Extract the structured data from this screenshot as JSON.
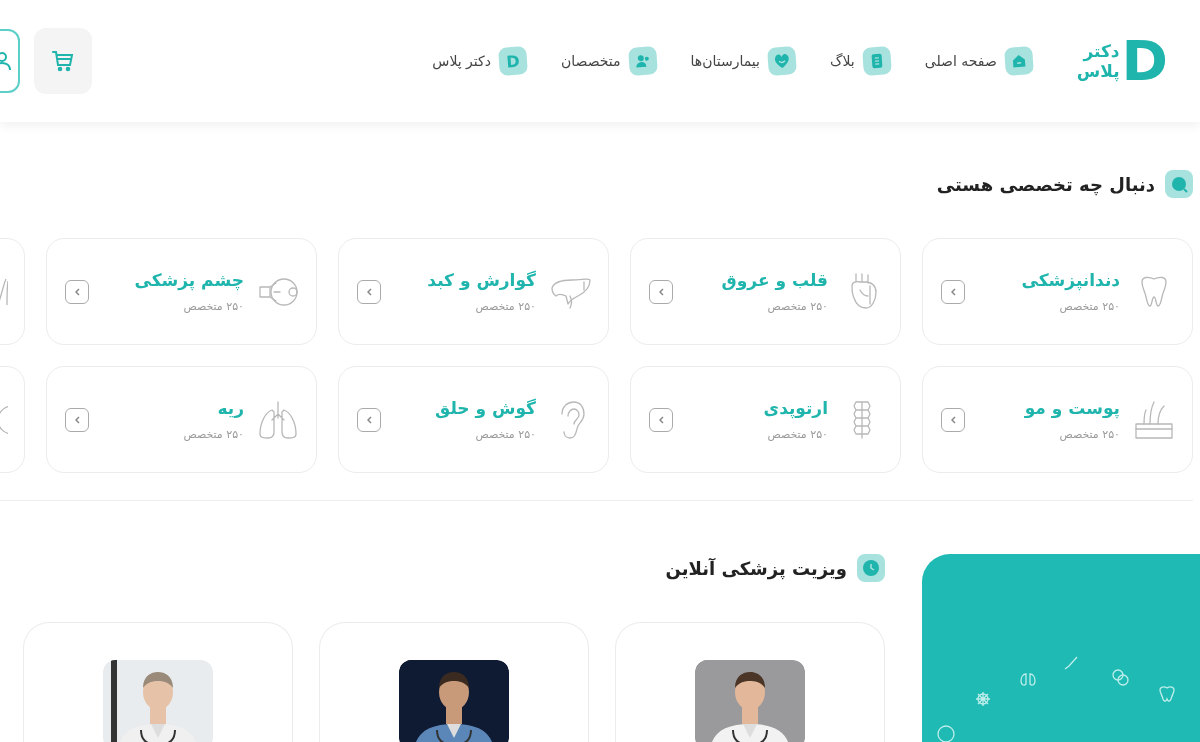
{
  "header": {
    "logo": {
      "mark": "D",
      "lines": [
        "دکتر",
        "پلاس"
      ]
    },
    "nav": [
      {
        "label": "صفحه اصلی"
      },
      {
        "label": "بلاگ"
      },
      {
        "label": "بیمارستان‌ها"
      },
      {
        "label": "متخصصان"
      },
      {
        "label": "دکتر پلاس",
        "badge": "D"
      }
    ]
  },
  "specialties_section": {
    "title": "دنبال چه تخصصی هستی",
    "items": [
      {
        "kind": "specialty",
        "title": "دندانپزشکی",
        "count": "۲۵۰ متخصص"
      },
      {
        "kind": "specialty",
        "title": "قلب و عروق",
        "count": "۲۵۰ متخصص"
      },
      {
        "kind": "specialty",
        "title": "گوارش و کبد",
        "count": "۲۵۰ متخصص"
      },
      {
        "kind": "specialty",
        "title": "چشم پزشکی",
        "count": "۲۵۰ متخصص"
      },
      {
        "kind": "cut_off"
      },
      {
        "kind": "specialty",
        "title": "پوست و مو",
        "count": "۲۵۰ متخصص"
      },
      {
        "kind": "specialty",
        "title": "ارتوپدی",
        "count": "۲۵۰ متخصص"
      },
      {
        "kind": "specialty",
        "title": "گوش و حلق",
        "count": "۲۵۰ متخصص"
      },
      {
        "kind": "specialty",
        "title": "ریه",
        "count": "۲۵۰ متخصص"
      },
      {
        "kind": "cut_off"
      }
    ]
  },
  "online_visit": {
    "title": "ویزیت پزشکی آنلاین"
  }
}
